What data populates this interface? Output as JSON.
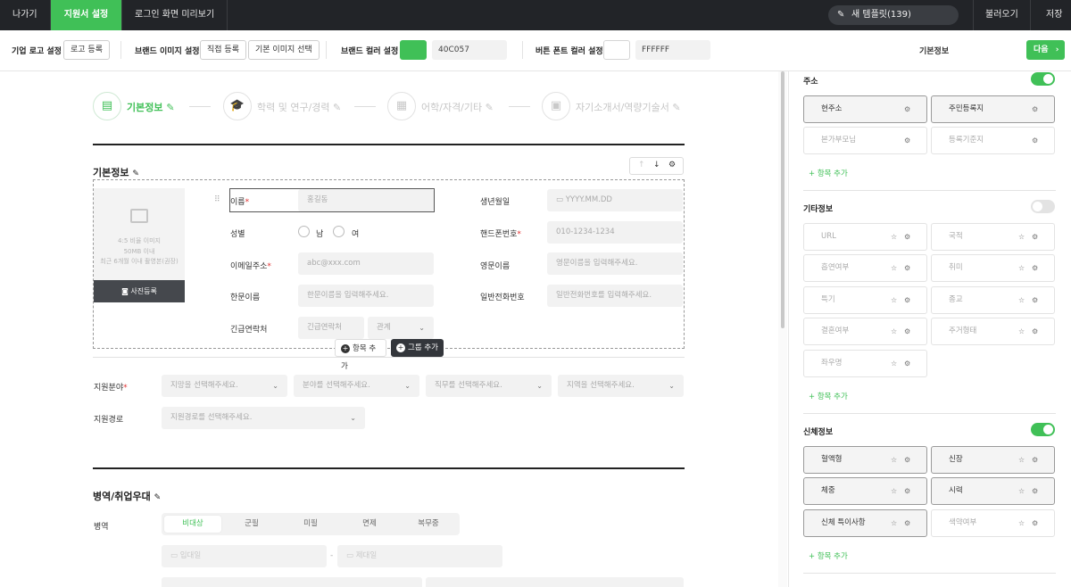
{
  "topbar": {
    "exit": "나가기",
    "applicant_settings": "지원서 설정",
    "login_preview": "로그인 화면 미리보기",
    "new_template": "새 템플릿(139)",
    "load": "불러오기",
    "save": "저장"
  },
  "toolbar": {
    "logo_label": "기업 로고 설정",
    "logo_btn": "로고 등록",
    "brand_image_label": "브랜드 이미지 설정",
    "direct_register": "직접 등록",
    "default_image": "기본 이미지 선택",
    "brand_color_label": "브랜드 컬러 설정",
    "brand_color_hex": "40C057",
    "brand_color": "#40c057",
    "button_font_label": "버튼 폰트 컬러 설정",
    "button_font_hex": "FFFFFF",
    "button_font_color": "#ffffff",
    "panel_title": "기본정보",
    "next": "다음"
  },
  "steps": [
    {
      "label": "기본정보",
      "icon": "document-icon",
      "active": true
    },
    {
      "label": "학력 및 연구/경력",
      "icon": "graduation-cap-icon",
      "active": false
    },
    {
      "label": "어학/자격/기타",
      "icon": "certificate-icon",
      "active": false
    },
    {
      "label": "자기소개서/역량기술서",
      "icon": "id-badge-icon",
      "active": false
    }
  ],
  "basic": {
    "title": "기본정보",
    "photo_line1": "4:5 비율 이미지",
    "photo_line2": "50MB 이내",
    "photo_line3": "최근 6개월 이내 촬영본(권장)",
    "photo_btn": "사진등록",
    "name_label": "이름",
    "name_placeholder": "홍길동",
    "birth_label": "생년월일",
    "birth_placeholder": "YYYY.MM.DD",
    "gender_label": "성별",
    "male": "남",
    "female": "여",
    "phone_label": "핸드폰번호",
    "phone_placeholder": "010-1234-1234",
    "email_label": "이메일주소",
    "email_placeholder": "abc@xxx.com",
    "eng_label": "영문이름",
    "eng_placeholder": "영문이름을 입력해주세요.",
    "hanja_label": "한문이름",
    "hanja_placeholder": "한문이름을 입력해주세요.",
    "tel_label": "일반전화번호",
    "tel_placeholder": "일반전화번호를 입력해주세요.",
    "emergency_label": "긴급연락처",
    "emergency_placeholder": "긴급연락처",
    "relation_placeholder": "관계",
    "add_item": "항목 추가",
    "add_group": "그룹 추가"
  },
  "apply": {
    "field_label": "지원분야",
    "select1": "지망을 선택해주세요.",
    "select2": "분야를 선택해주세요.",
    "select3": "직무를 선택해주세요.",
    "select4": "지역을 선택해주세요.",
    "route_label": "지원경로",
    "route_select": "지원경로를 선택해주세요."
  },
  "military": {
    "title": "병역/취업우대",
    "label": "병역",
    "options": [
      "비대상",
      "군필",
      "미필",
      "면제",
      "복무중"
    ],
    "enlist": "입대일",
    "discharge": "제대일",
    "tilde": "-"
  },
  "panel": {
    "address": {
      "title": "주소",
      "items": [
        "현주소",
        "주민등록지",
        "본가부모님",
        "등록기준지"
      ],
      "add": "항목 추가"
    },
    "etc": {
      "title": "기타정보",
      "items": [
        "URL",
        "국적",
        "흡연여부",
        "취미",
        "특기",
        "종교",
        "결혼여부",
        "주거형태",
        "좌우명"
      ],
      "add": "항목 추가"
    },
    "body": {
      "title": "신체정보",
      "items": [
        "혈액형",
        "신장",
        "체중",
        "시력",
        "신체 특이사항",
        "색약여부"
      ],
      "add": "항목 추가"
    }
  }
}
